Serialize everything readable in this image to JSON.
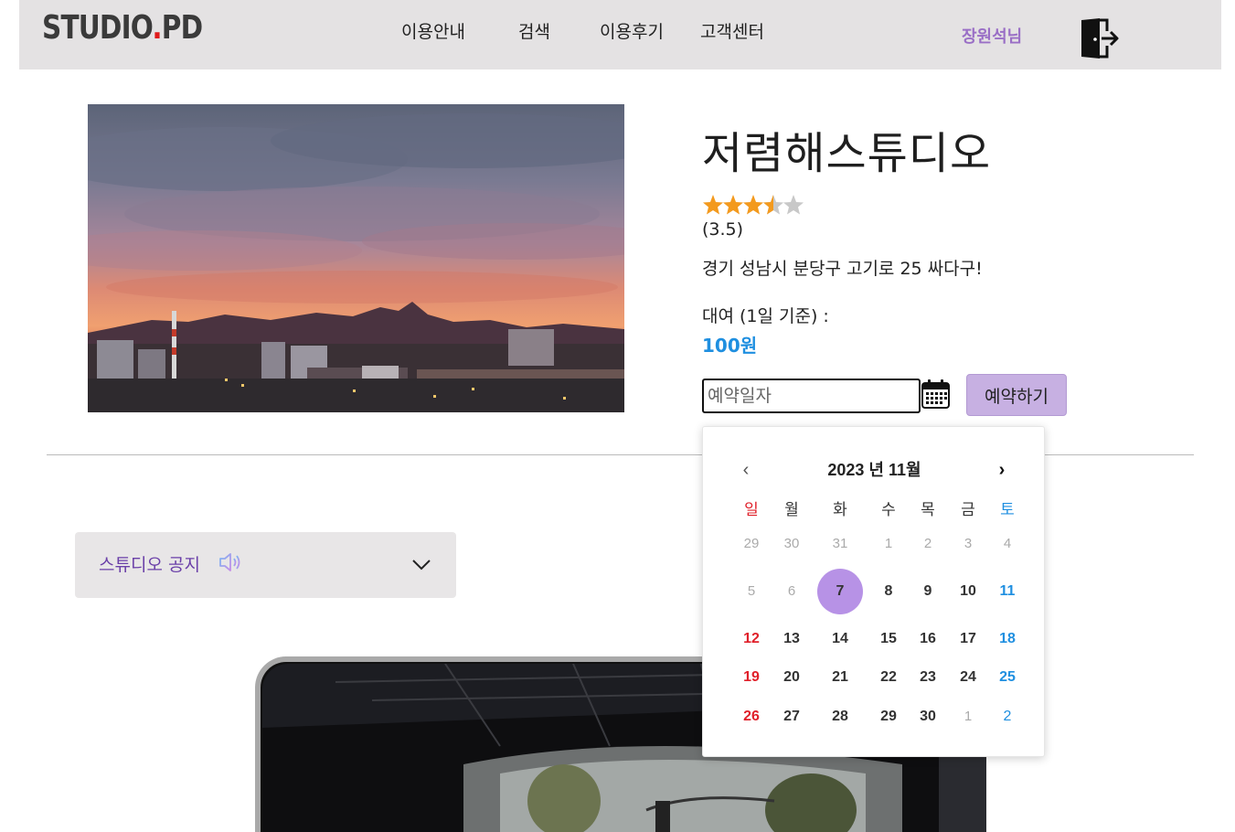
{
  "header": {
    "logo_prefix": "STUDIO",
    "logo_dot": ".",
    "logo_suffix": "PD",
    "nav": [
      "이용안내",
      "검색",
      "이용후기",
      "고객센터"
    ],
    "user_name": "장원석님"
  },
  "studio": {
    "name": "저렴해스튜디오",
    "rating": 3.5,
    "rating_text": "(3.5)",
    "address": "경기 성남시 분당구 고기로 25 싸다구!",
    "rent_label": "대여 (1일 기준) :",
    "price": "100원"
  },
  "reservation": {
    "date_placeholder": "예약일자",
    "reserve_label": "예약하기"
  },
  "notice": {
    "label": "스튜디오 공지"
  },
  "calendar": {
    "title": "2023 년 11월",
    "prev": "‹",
    "next": "›",
    "weekdays": [
      "일",
      "월",
      "화",
      "수",
      "목",
      "금",
      "토"
    ],
    "selected": "7",
    "weeks": [
      [
        "29",
        "30",
        "31",
        "1",
        "2",
        "3",
        "4"
      ],
      [
        "5",
        "6",
        "7",
        "8",
        "9",
        "10",
        "11"
      ],
      [
        "12",
        "13",
        "14",
        "15",
        "16",
        "17",
        "18"
      ],
      [
        "19",
        "20",
        "21",
        "22",
        "23",
        "24",
        "25"
      ],
      [
        "26",
        "27",
        "28",
        "29",
        "30",
        "1",
        "2"
      ]
    ]
  },
  "colors": {
    "accent_purple": "#b792e6",
    "price_blue": "#1f8fe0",
    "sunday_red": "#e0202a",
    "saturday_blue": "#1f8fe0",
    "star_orange": "#f39a1e"
  }
}
